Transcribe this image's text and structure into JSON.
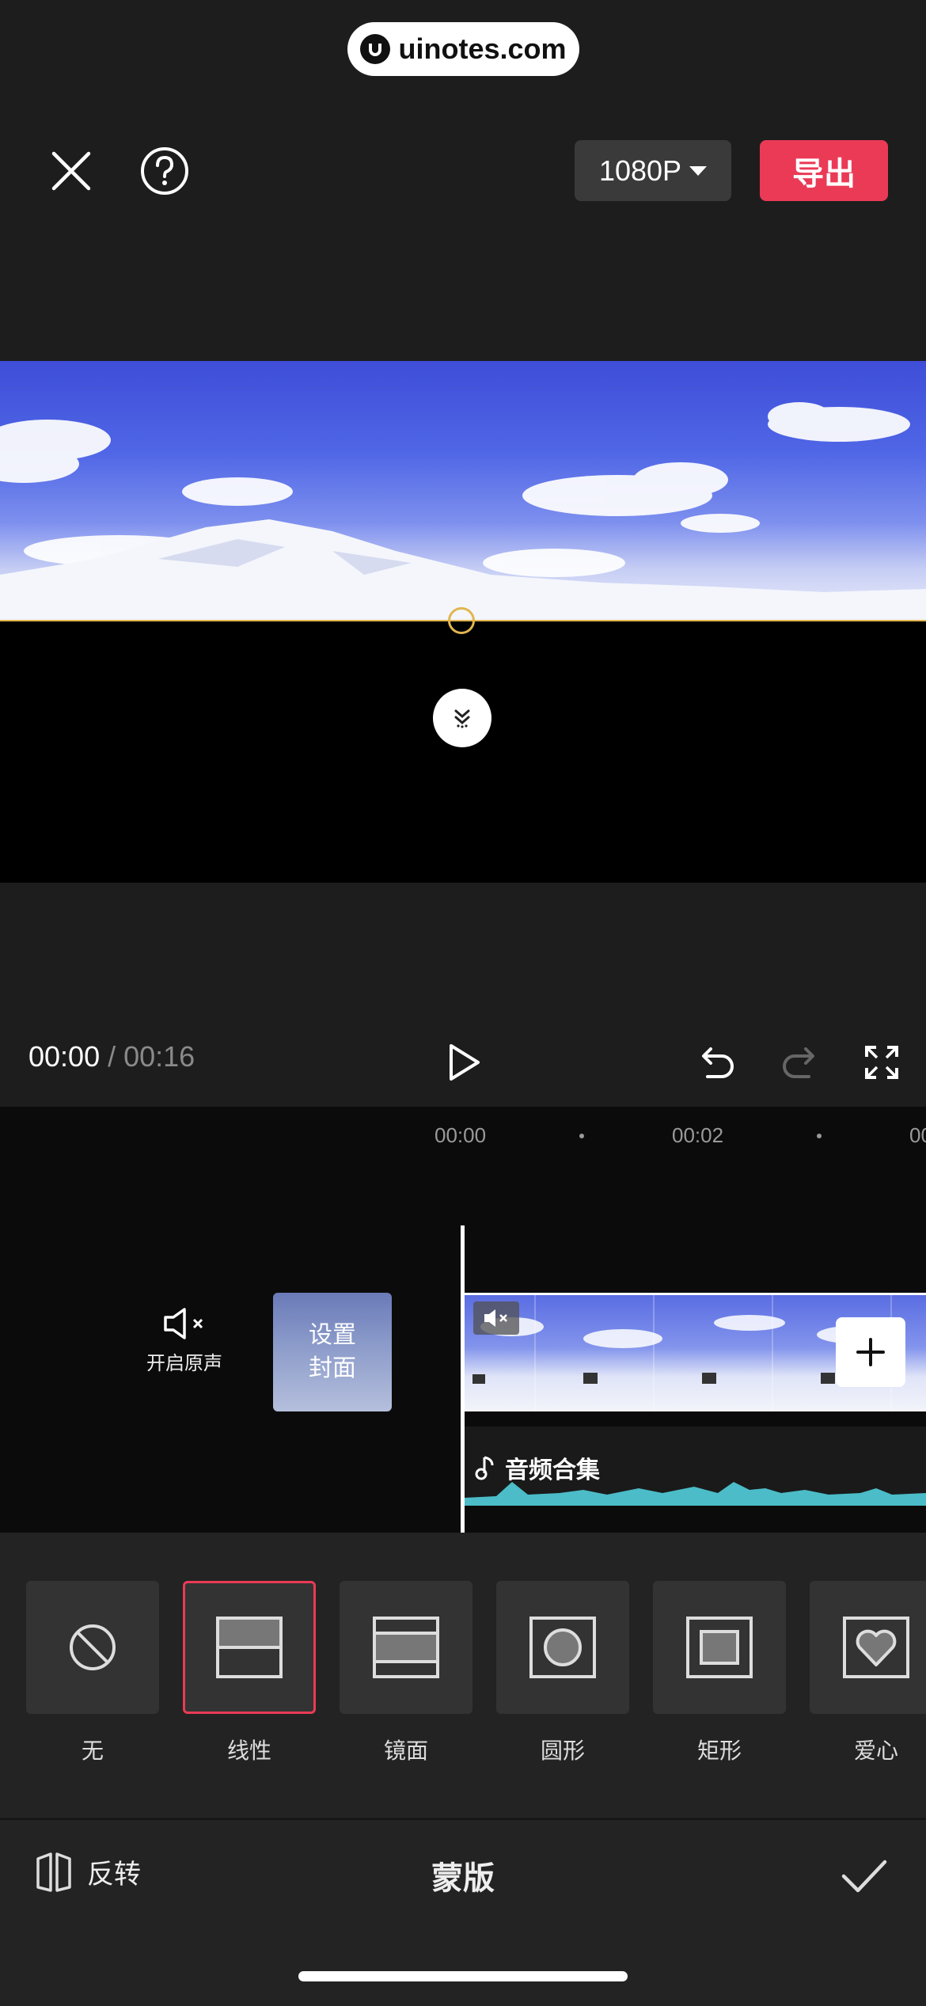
{
  "watermark": {
    "text": "uinotes.com"
  },
  "topbar": {
    "close_icon": "close-icon",
    "help_icon": "help-icon",
    "resolution": "1080P",
    "export": "导出",
    "accent_color": "#ea3a56"
  },
  "preview": {
    "mask_line_color": "#e2b54e"
  },
  "controls": {
    "current_time": "00:00",
    "separator": "/",
    "total_time": "00:16"
  },
  "timeline": {
    "ticks": [
      "00:00",
      "00:02",
      "00"
    ],
    "mute_label": "开启原声",
    "cover_label_line1": "设置",
    "cover_label_line2": "封面",
    "audio_label": "音频合集",
    "waveform_color": "#4bbcc8"
  },
  "mask_options": [
    {
      "label": "无",
      "icon": "none-icon",
      "selected": false
    },
    {
      "label": "线性",
      "icon": "linear-mask-icon",
      "selected": true
    },
    {
      "label": "镜面",
      "icon": "mirror-mask-icon",
      "selected": false
    },
    {
      "label": "圆形",
      "icon": "circle-mask-icon",
      "selected": false
    },
    {
      "label": "矩形",
      "icon": "rectangle-mask-icon",
      "selected": false
    },
    {
      "label": "爱心",
      "icon": "heart-mask-icon",
      "selected": false
    }
  ],
  "bottombar": {
    "invert_label": "反转",
    "title": "蒙版",
    "confirm_icon": "checkmark-icon"
  }
}
